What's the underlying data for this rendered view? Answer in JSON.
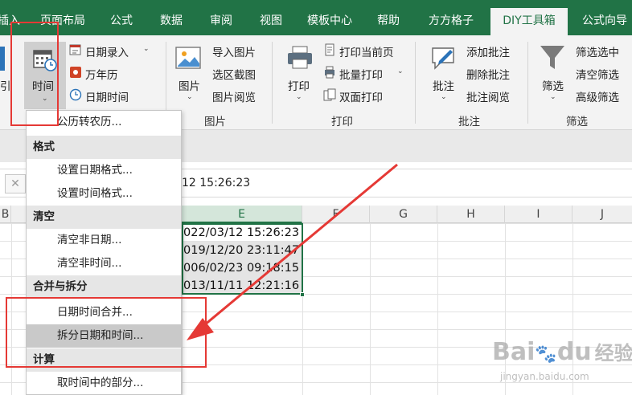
{
  "tabs": [
    {
      "label": "插入",
      "active": false
    },
    {
      "label": "页面布局",
      "active": false
    },
    {
      "label": "公式",
      "active": false
    },
    {
      "label": "数据",
      "active": false
    },
    {
      "label": "审阅",
      "active": false
    },
    {
      "label": "视图",
      "active": false
    },
    {
      "label": "模板中心",
      "active": false
    },
    {
      "label": "帮助",
      "active": false
    },
    {
      "label": "方方格子",
      "active": false
    },
    {
      "label": "DIY工具箱",
      "active": true
    },
    {
      "label": "公式向导",
      "active": false
    }
  ],
  "ribbon": {
    "partial_left_label": "引",
    "time_group": {
      "time_button": "时间",
      "date_entry": "日期录入",
      "calendar": "万年历",
      "datetime": "日期时间"
    },
    "picture_group": {
      "picture_button": "图片",
      "import_picture": "导入图片",
      "region_screenshot": "选区截图",
      "picture_browse": "图片阅览",
      "label": "图片"
    },
    "print_group": {
      "print_button": "打印",
      "print_current": "打印当前页",
      "batch_print": "批量打印",
      "duplex_print": "双面打印",
      "label": "打印"
    },
    "comment_group": {
      "comment_button": "批注",
      "add_comment": "添加批注",
      "delete_comment": "删除批注",
      "browse_comment": "批注阅览",
      "label": "批注"
    },
    "filter_group": {
      "filter_button": "筛选",
      "filter_selected": "筛选选中",
      "clear_filter": "清空筛选",
      "advanced_filter": "高级筛选",
      "label": "筛选"
    }
  },
  "formula_bar": {
    "cancel_symbol": "✕",
    "value": "12 15:26:23"
  },
  "columns": [
    "B",
    "E",
    "F",
    "G",
    "H",
    "I",
    "J"
  ],
  "cells": [
    "022/03/12 15:26:23",
    "019/12/20 23:11:47",
    "006/02/23 09:18:15",
    "013/11/11 12:21:16"
  ],
  "menu": {
    "items": [
      {
        "type": "item",
        "label": "公历转农历..."
      },
      {
        "type": "header",
        "label": "格式"
      },
      {
        "type": "item",
        "label": "设置日期格式..."
      },
      {
        "type": "item",
        "label": "设置时间格式..."
      },
      {
        "type": "header",
        "label": "清空"
      },
      {
        "type": "item",
        "label": "清空非日期..."
      },
      {
        "type": "item",
        "label": "清空非时间..."
      },
      {
        "type": "header",
        "label": "合并与拆分"
      },
      {
        "type": "item",
        "label": "日期时间合并..."
      },
      {
        "type": "item",
        "label": "拆分日期和时间...",
        "hover": true
      },
      {
        "type": "header",
        "label": "计算"
      },
      {
        "type": "item",
        "label": "取时间中的部分..."
      }
    ]
  },
  "watermark": {
    "brand": "Bai",
    "brand2": "du",
    "suffix": "经验",
    "url": "jingyan.baidu.com"
  },
  "colors": {
    "excel_green": "#217346",
    "annotation_red": "#e53935",
    "hover_gray": "#c9c9c9"
  }
}
